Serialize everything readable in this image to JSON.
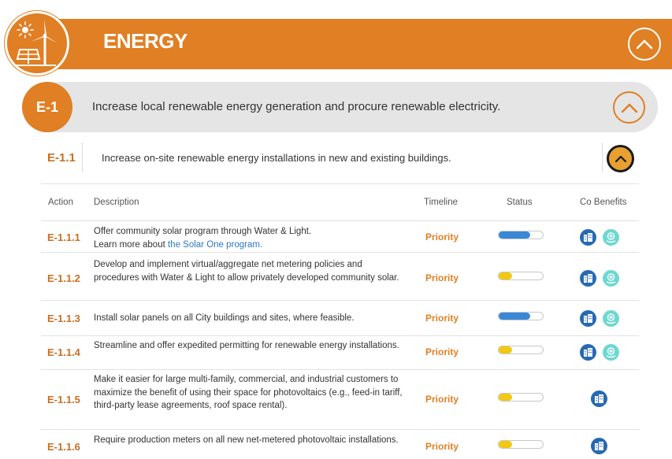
{
  "colors": {
    "accent": "#e07f23",
    "link": "#2e78c4",
    "status_blue": "#3a87d6",
    "status_yellow": "#f2c811"
  },
  "energy": {
    "title": "ENERGY",
    "icon": "solar-wind-icon"
  },
  "goal": {
    "code": "E-1",
    "text": "Increase local renewable energy generation and procure renewable electricity."
  },
  "strategy": {
    "code": "E-1.1",
    "text": "Increase on-site renewable energy installations in new and existing buildings."
  },
  "table": {
    "headers": {
      "action": "Action",
      "description": "Description",
      "timeline": "Timeline",
      "status": "Status",
      "co_benefits": "Co Benefits"
    },
    "rows": [
      {
        "code": "E-1.1.1",
        "desc_line1": "Offer community solar program through Water & Light.",
        "desc_pre": "Learn more about ",
        "desc_link": "the Solar One program.",
        "timeline": "Priority",
        "status_fraction": 0.72,
        "status_color": "#3a87d6",
        "benefits": [
          "building-icon",
          "health-icon"
        ]
      },
      {
        "code": "E-1.1.2",
        "description": "Develop and implement virtual/aggregate net metering policies and procedures with Water & Light to allow privately developed community solar.",
        "timeline": "Priority",
        "status_fraction": 0.3,
        "status_color": "#f2c811",
        "benefits": [
          "building-icon",
          "health-icon"
        ]
      },
      {
        "code": "E-1.1.3",
        "description": "Install solar panels on all City buildings and sites, where feasible.",
        "timeline": "Priority",
        "status_fraction": 0.72,
        "status_color": "#3a87d6",
        "benefits": [
          "building-icon",
          "health-icon"
        ]
      },
      {
        "code": "E-1.1.4",
        "description": "Streamline and offer expedited permitting for renewable energy installations.",
        "timeline": "Priority",
        "status_fraction": 0.3,
        "status_color": "#f2c811",
        "benefits": [
          "building-icon",
          "health-icon"
        ]
      },
      {
        "code": "E-1.1.5",
        "description": "Make it easier for large multi-family, commercial, and industrial customers to maximize the benefit of using their space for photovoltaics (e.g., feed-in tariff, third-party lease agreements, roof space rental).",
        "timeline": "Priority",
        "status_fraction": 0.3,
        "status_color": "#f2c811",
        "benefits": [
          "building-icon"
        ]
      },
      {
        "code": "E-1.1.6",
        "description": "Require production meters on all new net-metered photovoltaic installations.",
        "timeline": "Priority",
        "status_fraction": 0.3,
        "status_color": "#f2c811",
        "benefits": [
          "building-icon"
        ]
      }
    ]
  }
}
